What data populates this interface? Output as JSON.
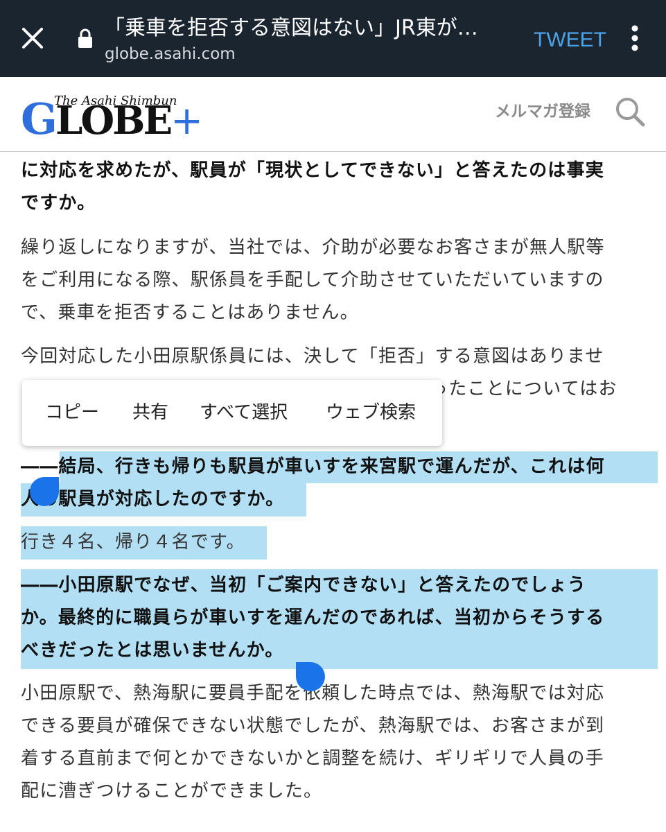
{
  "browser": {
    "title": "「乗車を拒否する意図はない」JR東が…",
    "url": "globe.asahi.com",
    "tweet_label": "TWEET"
  },
  "site": {
    "logo_top": "The Asahi Shimbun",
    "logo_g": "G",
    "logo_rest": "LOBE",
    "logo_plus": "+",
    "mailmag_label": "メルマガ登録"
  },
  "article": {
    "p1_line1": "に対応を求めたが、駅員が「現状としてできない」と答えたのは事実",
    "p1_line2": "ですか。",
    "p2_line1": "繰り返しになりますが、当社では、介助が必要なお客さまが無人駅等",
    "p2_line2": "をご利用になる際、駅係員を手配して介助させていただいていますの",
    "p2_line3": "で、乗車を拒否することはありません。",
    "p3_line1": "今回対応した小田原駅係員には、決して「拒否」する意図はありませ",
    "p3_line2_visible": "ったことについてはお",
    "q2_line1": "――結局、行きも帰りも駅員が車いすを来宮駅で運んだが、これは何",
    "q2_line2": "人の駅員が対応したのですか。",
    "a2_line1": "行き４名、帰り４名です。",
    "q3_line1": "――小田原駅でなぜ、当初「ご案内できない」と答えたのでしょう",
    "q3_line2": "か。最終的に職員らが車いすを運んだのであれば、当初からそうする",
    "q3_line3": "べきだったとは思いませんか。",
    "a3_line1": "小田原駅で、熱海駅に要員手配を依頼した時点では、熱海駅では対応",
    "a3_line2": "できる要員が確保できない状態でしたが、熱海駅では、お客さまが到",
    "a3_line3": "着する直前まで何とかできないかと調整を続け、ギリギリで人員の手",
    "a3_line4": "配に漕ぎつけることができました。"
  },
  "context_menu": {
    "copy": "コピー",
    "share": "共有",
    "select_all": "すべて選択",
    "web_search": "ウェブ検索"
  },
  "colors": {
    "topbar_bg": "#1b2530",
    "tweet": "#4aa3e8",
    "selection": "#b3dff5",
    "handle": "#1a73e8",
    "logo_blue": "#2f6fdc"
  }
}
